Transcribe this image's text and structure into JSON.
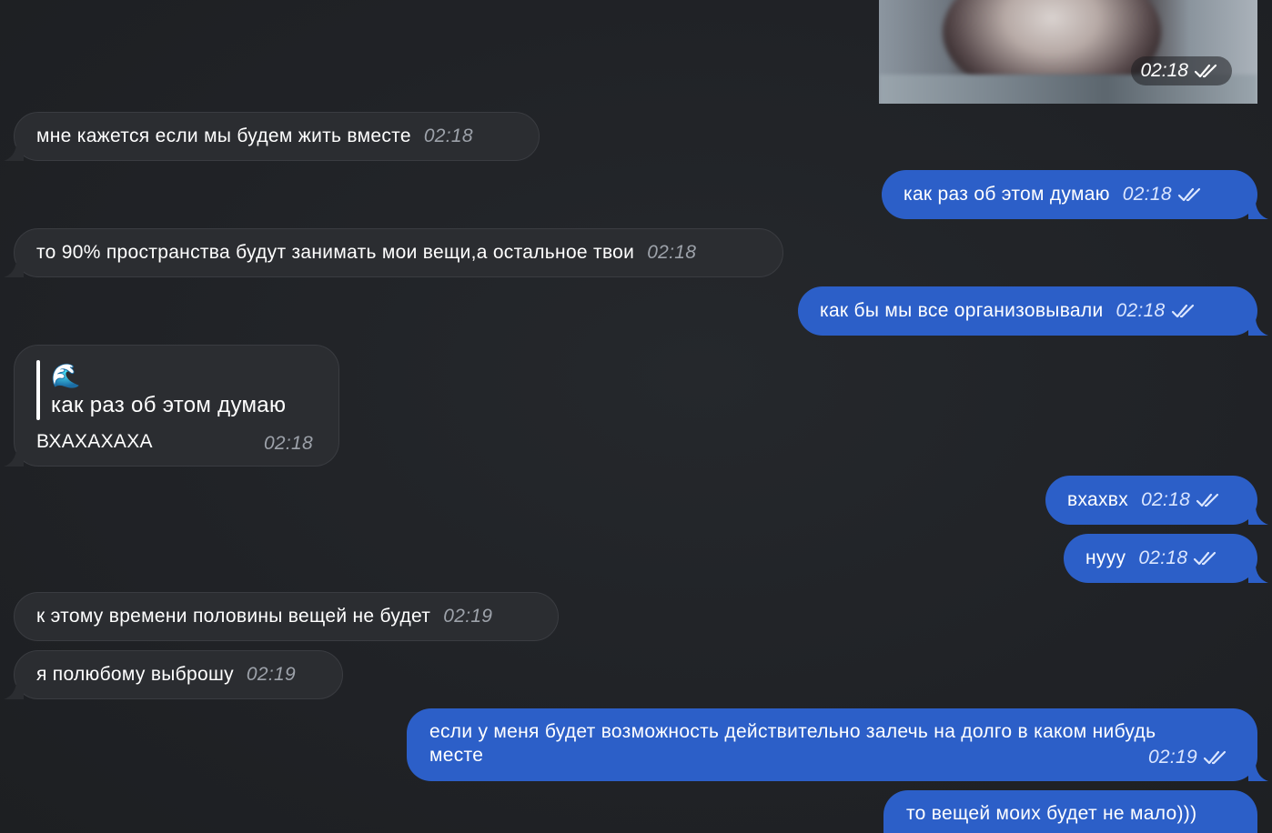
{
  "photo_message": {
    "time": "02:18",
    "status": "read"
  },
  "messages": [
    {
      "side": "in",
      "text": "мне кажется если мы будем жить вместе",
      "time": "02:18"
    },
    {
      "side": "out",
      "text": "как раз об этом думаю",
      "time": "02:18"
    },
    {
      "side": "in",
      "text": "то 90% пространства будут занимать мои вещи,а остальное твои",
      "time": "02:18"
    },
    {
      "side": "out",
      "text": "как бы мы все организовывали",
      "time": "02:18"
    },
    {
      "side": "in",
      "reply": {
        "emoji": "🌊",
        "quoted_text": "как раз об этом думаю"
      },
      "text": "ВХАХАХАХА",
      "time": "02:18"
    },
    {
      "side": "out",
      "text": "вхахвх",
      "time": "02:18"
    },
    {
      "side": "out",
      "text": "нууу",
      "time": "02:18"
    },
    {
      "side": "in",
      "text": "к этому времени половины вещей не будет",
      "time": "02:19"
    },
    {
      "side": "in",
      "text": "я полюбому выброшу",
      "time": "02:19"
    },
    {
      "side": "out",
      "text_line1": "если у меня будет возможность действительно залечь на долго в каком нибудь",
      "text_line2": "месте",
      "time": "02:19"
    },
    {
      "side": "out",
      "text": "то вещей моих будет не мало)))"
    }
  ],
  "colors": {
    "incoming_bubble": "#2b2d31",
    "outgoing_bubble": "#2c5fc8",
    "background": "#212327"
  },
  "icons": {
    "read_status": "double-check-icon"
  }
}
